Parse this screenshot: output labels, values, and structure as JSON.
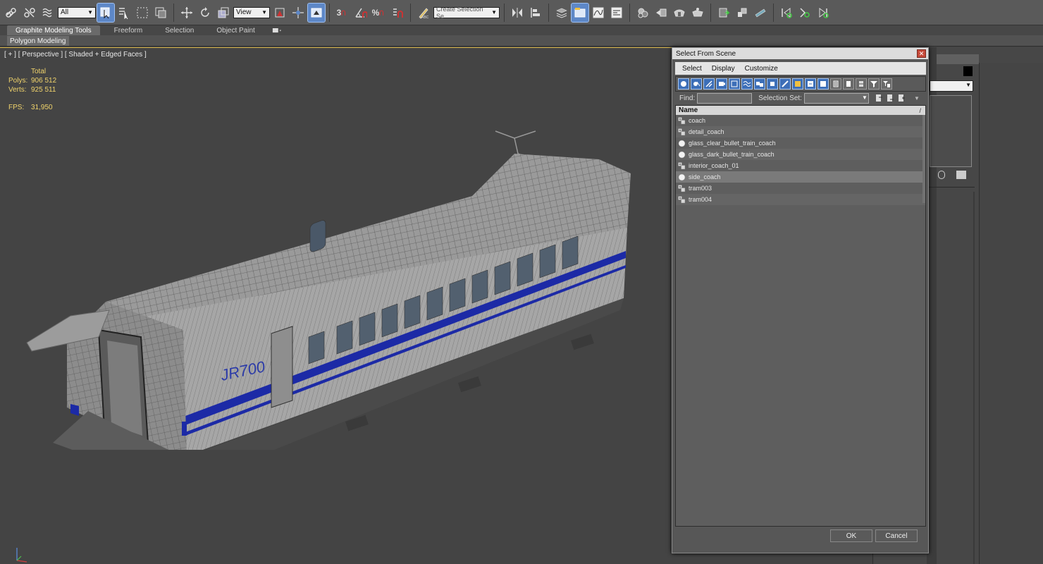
{
  "toolbar": {
    "filter_value": "All",
    "ref_coord_value": "View",
    "snap_label": "3",
    "angle_snap_label": "",
    "percent_snap_label": "%",
    "selection_set_placeholder": "Create Selection Se"
  },
  "ribbon": {
    "tabs": [
      "Graphite Modeling Tools",
      "Freeform",
      "Selection",
      "Object Paint"
    ],
    "active_tab": "Graphite Modeling Tools",
    "sub_button": "Polygon Modeling"
  },
  "viewport": {
    "label": "[ + ] [ Perspective ] [ Shaded + Edged Faces ]",
    "stats": {
      "header": "Total",
      "polys_label": "Polys:",
      "polys_value": "906 512",
      "verts_label": "Verts:",
      "verts_value": "925 511",
      "fps_label": "FPS:",
      "fps_value": "31,950"
    },
    "model_logo": "JR700"
  },
  "dialog": {
    "title": "Select From Scene",
    "close_glyph": "✕",
    "menu": [
      "Select",
      "Display",
      "Customize"
    ],
    "find_label": "Find:",
    "selection_set_label": "Selection Set:",
    "list_header": "Name",
    "list_header_sort": "/",
    "items": [
      {
        "name": "coach",
        "icon": "geometry"
      },
      {
        "name": "detail_coach",
        "icon": "geometry"
      },
      {
        "name": "glass_clear_bullet_train_coach",
        "icon": "sphere"
      },
      {
        "name": "glass_dark_bullet_train_coach",
        "icon": "sphere"
      },
      {
        "name": "interior_coach_01",
        "icon": "geometry"
      },
      {
        "name": "side_coach",
        "icon": "sphere"
      },
      {
        "name": "tram003",
        "icon": "geometry"
      },
      {
        "name": "tram004",
        "icon": "geometry"
      }
    ],
    "ok_label": "OK",
    "cancel_label": "Cancel"
  },
  "colors": {
    "active_blue": "#5d87c7",
    "viewport_bg": "#444444",
    "stats_yellow": "#f0d36b",
    "train_stripe": "#1c2aa6"
  }
}
